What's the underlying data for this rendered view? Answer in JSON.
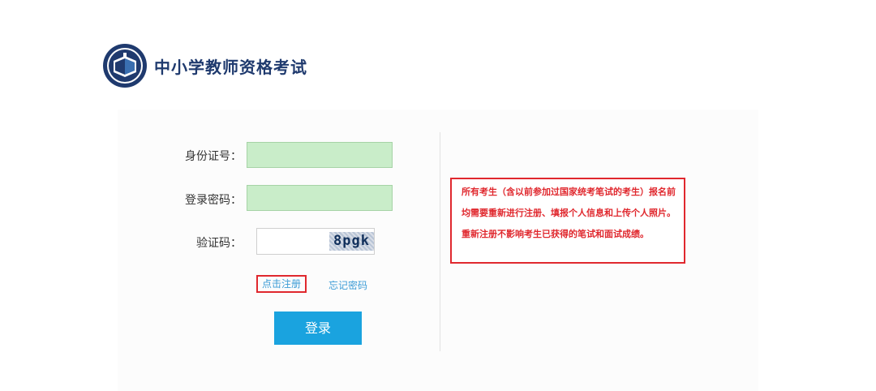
{
  "header": {
    "logo_icon": "education-seal-logo",
    "title": "中小学教师资格考试"
  },
  "login_form": {
    "id_label": "身份证号：",
    "id_value": "",
    "password_label": "登录密码：",
    "password_value": "",
    "captcha_label": "验证码：",
    "captcha_value": "",
    "captcha_image_text": "8pgk",
    "register_link": "点击注册",
    "forgot_link": "忘记密码",
    "login_button": "登录"
  },
  "notice": {
    "text": "所有考生（含以前参加过国家统考笔试的考生）报名前均需要重新进行注册、填报个人信息和上传个人照片。重新注册不影响考生已获得的笔试和面试成绩。"
  },
  "colors": {
    "title": "#1f3a6e",
    "input_fill": "#c9edc9",
    "link": "#3c9cd6",
    "button": "#1aa3df",
    "highlight_red": "#e0282e"
  }
}
